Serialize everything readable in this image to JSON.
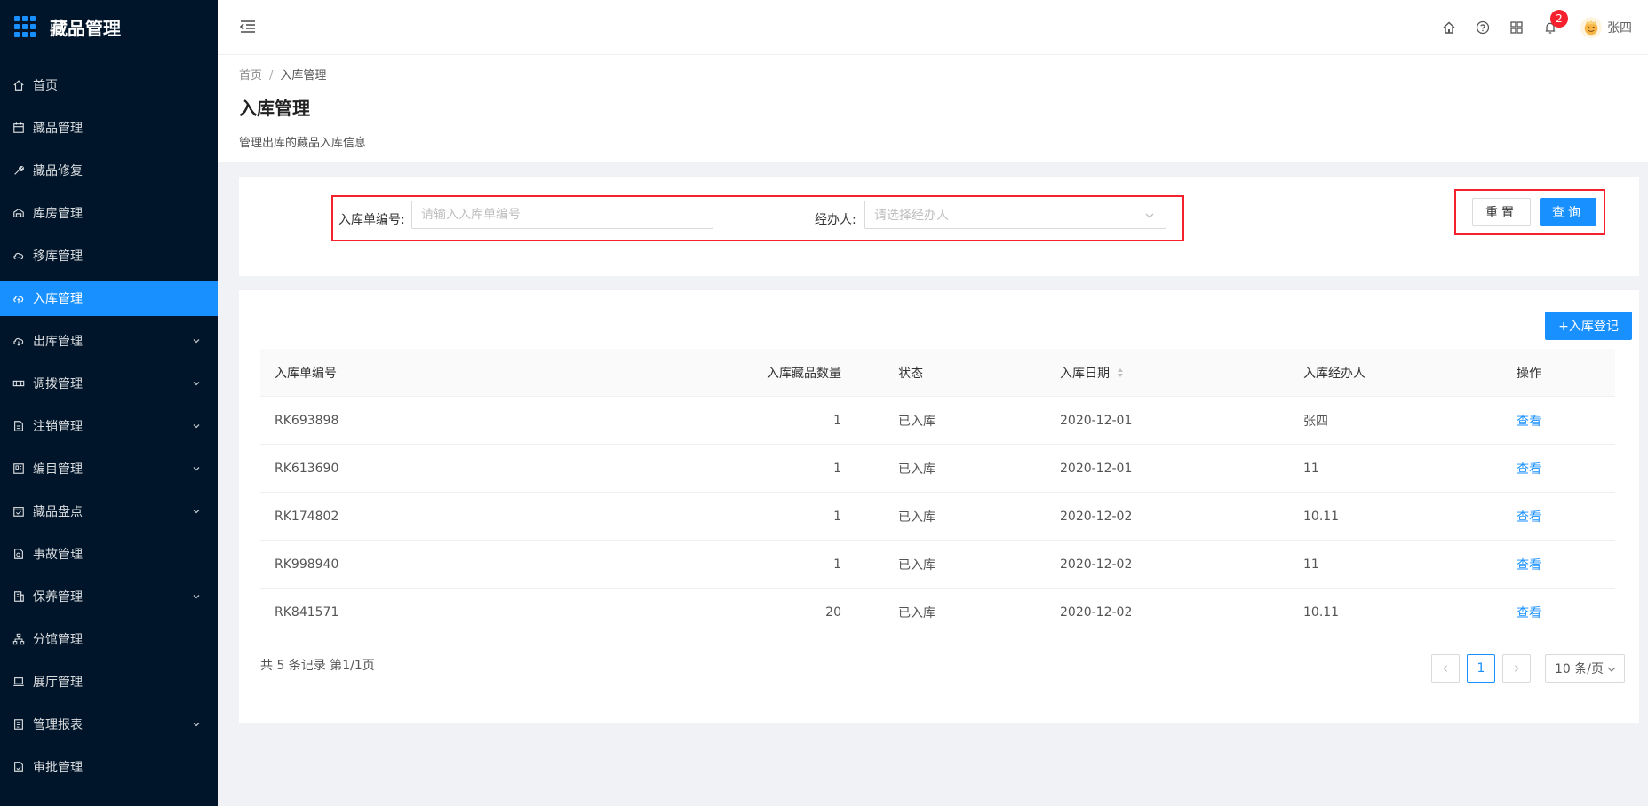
{
  "app": {
    "title": "藏品管理"
  },
  "colors": {
    "accent": "#1890ff",
    "sidebar_bg": "#001529",
    "highlight": "#f5222d"
  },
  "sidebar": {
    "items": [
      {
        "label": "首页",
        "icon": "home-icon",
        "has_children": false,
        "active": false
      },
      {
        "label": "藏品管理",
        "icon": "calendar-icon",
        "has_children": false,
        "active": false
      },
      {
        "label": "藏品修复",
        "icon": "wrench-icon",
        "has_children": false,
        "active": false
      },
      {
        "label": "库房管理",
        "icon": "warehouse-icon",
        "has_children": false,
        "active": false
      },
      {
        "label": "移库管理",
        "icon": "cloud-transfer-icon",
        "has_children": false,
        "active": false
      },
      {
        "label": "入库管理",
        "icon": "cloud-upload-icon",
        "has_children": false,
        "active": true
      },
      {
        "label": "出库管理",
        "icon": "cloud-download-icon",
        "has_children": true,
        "active": false
      },
      {
        "label": "调拨管理",
        "icon": "transfer-icon",
        "has_children": true,
        "active": false
      },
      {
        "label": "注销管理",
        "icon": "file-icon",
        "has_children": true,
        "active": false
      },
      {
        "label": "编目管理",
        "icon": "catalog-icon",
        "has_children": true,
        "active": false
      },
      {
        "label": "藏品盘点",
        "icon": "calendar-check-icon",
        "has_children": true,
        "active": false
      },
      {
        "label": "事故管理",
        "icon": "file-search-icon",
        "has_children": false,
        "active": false
      },
      {
        "label": "保养管理",
        "icon": "building-icon",
        "has_children": true,
        "active": false
      },
      {
        "label": "分馆管理",
        "icon": "cluster-icon",
        "has_children": false,
        "active": false
      },
      {
        "label": "展厅管理",
        "icon": "laptop-icon",
        "has_children": false,
        "active": false
      },
      {
        "label": "管理报表",
        "icon": "report-icon",
        "has_children": true,
        "active": false
      },
      {
        "label": "审批管理",
        "icon": "audit-icon",
        "has_children": false,
        "active": false
      }
    ]
  },
  "header": {
    "notification_count": "2",
    "username": "张四"
  },
  "breadcrumb": {
    "home": "首页",
    "sep": "/",
    "current": "入库管理"
  },
  "page": {
    "title": "入库管理",
    "description": "管理出库的藏品入库信息"
  },
  "search": {
    "order_label": "入库单编号:",
    "order_placeholder": "请输入入库单编号",
    "handler_label": "经办人:",
    "handler_placeholder": "请选择经办人",
    "reset_label": "重置",
    "query_label": "查询"
  },
  "table": {
    "add_label": "+入库登记",
    "columns": [
      "入库单编号",
      "入库藏品数量",
      "状态",
      "入库日期",
      "入库经办人",
      "操作"
    ],
    "rows": [
      {
        "id": "RK693898",
        "count": "1",
        "status": "已入库",
        "date": "2020-12-01",
        "handler": "张四",
        "action": "查看"
      },
      {
        "id": "RK613690",
        "count": "1",
        "status": "已入库",
        "date": "2020-12-01",
        "handler": "11",
        "action": "查看"
      },
      {
        "id": "RK174802",
        "count": "1",
        "status": "已入库",
        "date": "2020-12-02",
        "handler": "10.11",
        "action": "查看"
      },
      {
        "id": "RK998940",
        "count": "1",
        "status": "已入库",
        "date": "2020-12-02",
        "handler": "11",
        "action": "查看"
      },
      {
        "id": "RK841571",
        "count": "20",
        "status": "已入库",
        "date": "2020-12-02",
        "handler": "10.11",
        "action": "查看"
      }
    ]
  },
  "pagination": {
    "summary": "共 5 条记录 第1/1页",
    "current_page": "1",
    "page_size": "10 条/页"
  }
}
